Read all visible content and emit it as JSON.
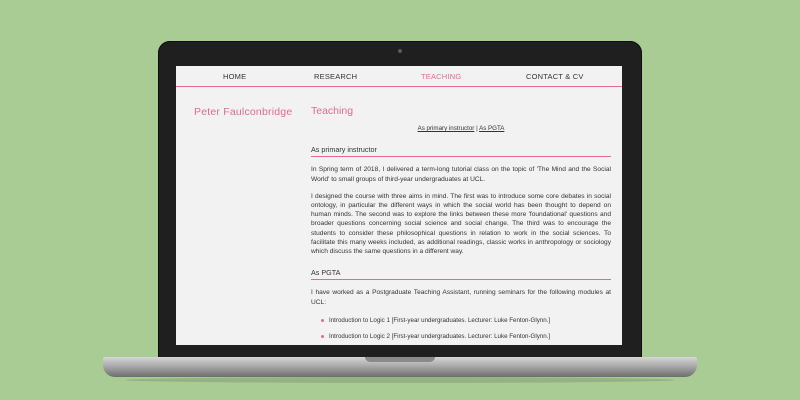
{
  "site": {
    "owner_name": "Peter Faulconbridge",
    "nav": {
      "items": [
        {
          "label": "HOME"
        },
        {
          "label": "RESEARCH"
        },
        {
          "label": "TEACHING"
        },
        {
          "label": "CONTACT & CV"
        }
      ],
      "active_index": 2
    },
    "page": {
      "title": "Teaching",
      "sublinks": {
        "primary": "As primary instructor",
        "separator": "|",
        "pgta": "As PGTA"
      },
      "sections": {
        "primary": {
          "heading": "As primary instructor",
          "paragraphs": [
            "In Spring term of 2018, I delivered a term-long tutorial class on the topic of 'The Mind and the Social World' to small groups of third-year undergraduates at UCL.",
            "I designed the course with three aims in mind. The first was to introduce some core debates in social ontology, in particular the different ways in which the social world has been thought to depend on human minds. The second was to explore the links between these more 'foundational' questions and broader questions concerning social science and social change. The third was to encourage the students to consider these philosophical questions in relation to work in the social sciences. To facilitate this many weeks included, as additional readings, classic works in anthropology or sociology which discuss the same questions in a different way."
          ]
        },
        "pgta": {
          "heading": "As PGTA",
          "intro": "I have worked as a Postgraduate Teaching Assistant, running seminars for the following modules at UCL:",
          "modules": [
            "Introduction to Logic 1 [First-year undergraduates. Lecturer: Luke Fenton-Glynn.]",
            "Introduction to Logic 2 [First-year undergraduates. Lecturer: Luke Fenton-Glynn.]"
          ]
        }
      }
    }
  },
  "colors": {
    "background": "#a8cc94",
    "accent_pink": "#e36a95",
    "screen_bg": "#f2f2f2",
    "laptop_dark": "#1f1f1f"
  }
}
